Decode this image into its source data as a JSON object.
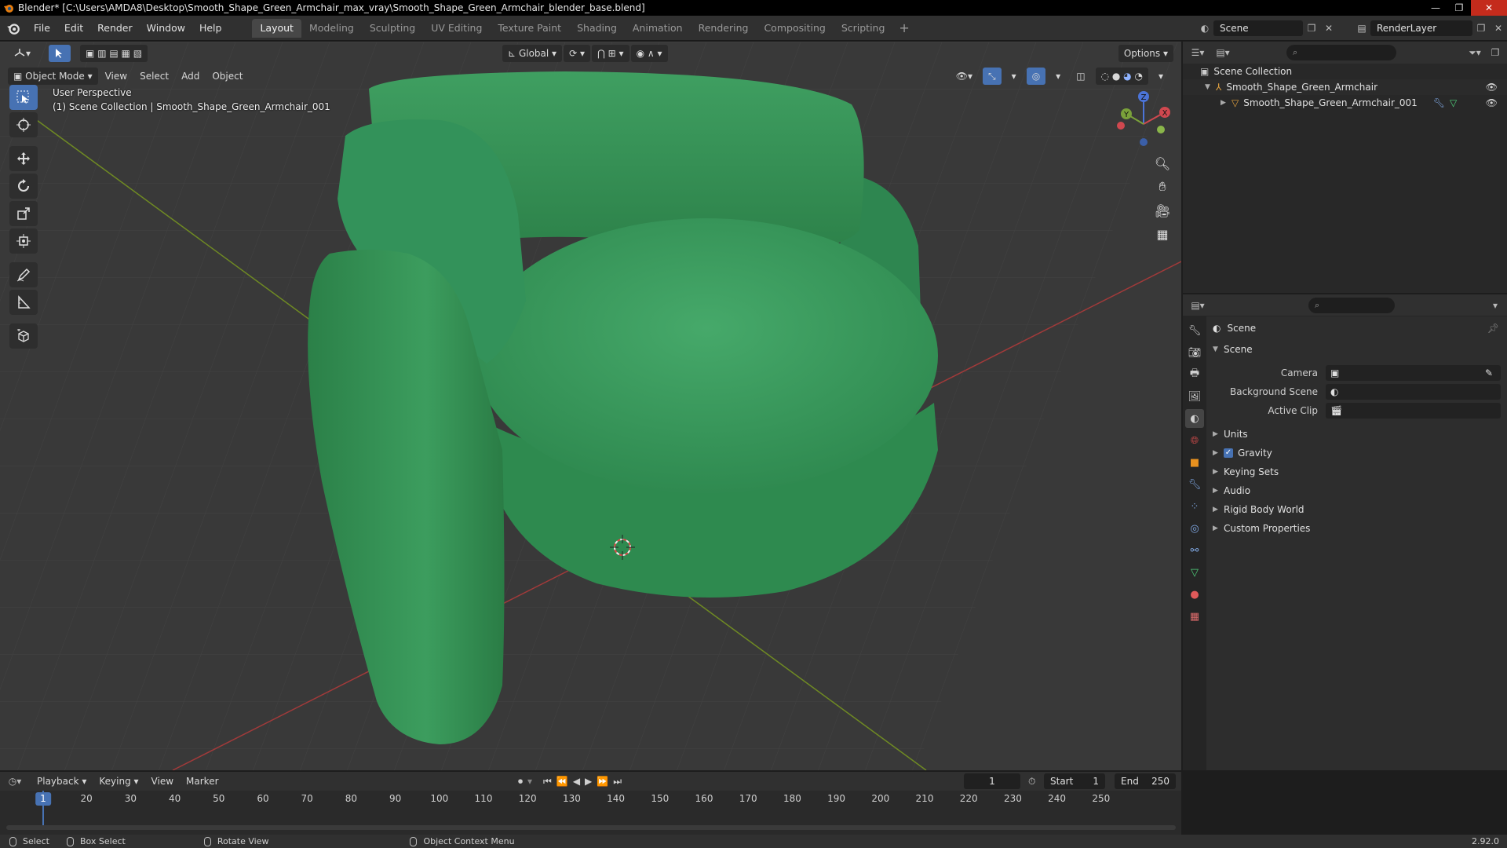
{
  "titlebar": {
    "title": "Blender* [C:\\Users\\AMDA8\\Desktop\\Smooth_Shape_Green_Armchair_max_vray\\Smooth_Shape_Green_Armchair_blender_base.blend]",
    "minimize": "—",
    "maximize": "❐",
    "close": "✕"
  },
  "menu": [
    "File",
    "Edit",
    "Render",
    "Window",
    "Help"
  ],
  "workspaces": [
    "Layout",
    "Modeling",
    "Sculpting",
    "UV Editing",
    "Texture Paint",
    "Shading",
    "Animation",
    "Rendering",
    "Compositing",
    "Scripting"
  ],
  "workspace_add": "+",
  "active_workspace": "Layout",
  "scene_selector": "Scene",
  "render_layer": "RenderLayer",
  "viewport": {
    "mode": "Object Mode",
    "menus": [
      "View",
      "Select",
      "Add",
      "Object"
    ],
    "transform_orientation": "Global",
    "options": "Options",
    "info_line1": "User Perspective",
    "info_line2": "(1) Scene Collection | Smooth_Shape_Green_Armchair_001",
    "gizmo": {
      "x": "X",
      "y": "Y",
      "z": "Z"
    },
    "colors": {
      "background": "#393939",
      "object": "#3b9a5c",
      "object_dark": "#237a43",
      "x_axis": "#a13a3a",
      "y_axis": "#6f8a23"
    }
  },
  "outliner": {
    "search_placeholder": "⌕",
    "root": "Scene Collection",
    "items": [
      {
        "label": "Smooth_Shape_Green_Armchair"
      },
      {
        "label": "Smooth_Shape_Green_Armchair_001"
      }
    ]
  },
  "properties": {
    "search_placeholder": "⌕",
    "context": "Scene",
    "panel_title": "Scene",
    "fields": [
      {
        "label": "Camera"
      },
      {
        "label": "Background Scene"
      },
      {
        "label": "Active Clip"
      }
    ],
    "subpanels": [
      "Units",
      "Gravity",
      "Keying Sets",
      "Audio",
      "Rigid Body World",
      "Custom Properties"
    ]
  },
  "timeline": {
    "menus": [
      "Playback",
      "Keying",
      "View",
      "Marker"
    ],
    "current_frame": "1",
    "start_label": "Start",
    "start": "1",
    "end_label": "End",
    "end": "250",
    "ticks": [
      "10",
      "20",
      "30",
      "40",
      "50",
      "60",
      "70",
      "80",
      "90",
      "100",
      "110",
      "120",
      "130",
      "140",
      "150",
      "160",
      "170",
      "180",
      "190",
      "200",
      "210",
      "220",
      "230",
      "240",
      "250"
    ]
  },
  "statusbar": {
    "select": "Select",
    "box_select": "Box Select",
    "rotate_view": "Rotate View",
    "context_menu": "Object Context Menu",
    "version": "2.92.0"
  }
}
